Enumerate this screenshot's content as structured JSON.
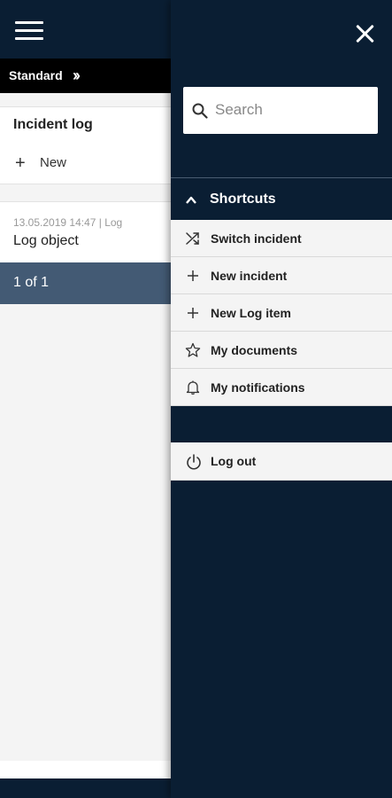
{
  "colors": {
    "header": "#0a1e33",
    "pager": "#435a74",
    "panel": "#f4f4f4"
  },
  "breadcrumb": {
    "label": "Standard"
  },
  "list": {
    "title": "Incident log",
    "new_label": "New",
    "items": [
      {
        "meta": "13.05.2019 14:47 | Log",
        "name": "Log object"
      }
    ],
    "pager": "1 of 1"
  },
  "drawer": {
    "search_placeholder": "Search",
    "shortcuts_title": "Shortcuts",
    "items": [
      {
        "label": "Switch incident",
        "icon": "shuffle-icon"
      },
      {
        "label": "New incident",
        "icon": "plus-icon"
      },
      {
        "label": "New Log item",
        "icon": "plus-icon"
      },
      {
        "label": "My documents",
        "icon": "star-icon"
      },
      {
        "label": "My notifications",
        "icon": "bell-icon"
      }
    ],
    "logout_label": "Log out"
  }
}
